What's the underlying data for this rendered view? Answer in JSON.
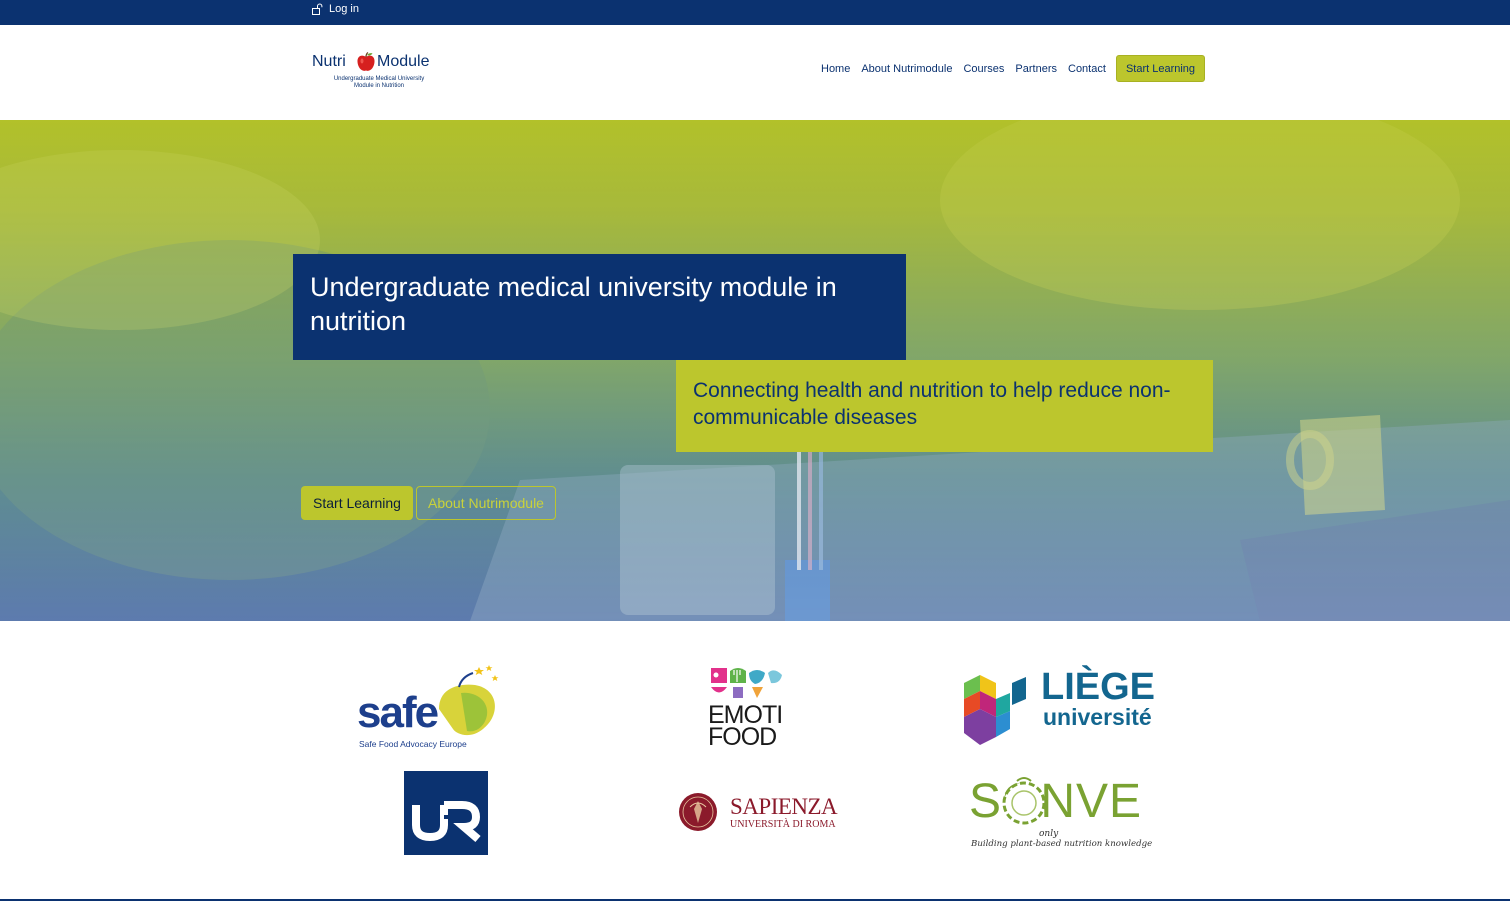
{
  "topbar": {
    "login_label": "Log in"
  },
  "logo": {
    "word1": "Nutri",
    "word2": "Module",
    "tagline_line1": "Undergraduate Medical University",
    "tagline_line2": "Module in Nutrition"
  },
  "nav": {
    "items": [
      {
        "label": "Home"
      },
      {
        "label": "About Nutrimodule"
      },
      {
        "label": "Courses"
      },
      {
        "label": "Partners"
      },
      {
        "label": "Contact"
      }
    ],
    "cta_label": "Start Learning"
  },
  "hero": {
    "headline": "Undergraduate medical university module in nutrition",
    "subheadline": "Connecting health and nutrition to help reduce non-communicable diseases",
    "primary_button": "Start Learning",
    "secondary_button": "About Nutrimodule"
  },
  "partners": {
    "safe": {
      "name": "safe",
      "subtitle": "Safe Food Advocacy Europe"
    },
    "emotifood": {
      "line1": "EMOTI",
      "line2": "FOOD"
    },
    "liege": {
      "line1": "LIÈGE",
      "line2": "université"
    },
    "ur": {
      "mark": "UR"
    },
    "sapienza": {
      "line1": "SAPIENZA",
      "line2": "UNIVERSITÀ DI ROMA"
    },
    "sonve": {
      "word": "SONVE",
      "small": "only",
      "tagline": "Building plant-based nutrition knowledge"
    }
  },
  "colors": {
    "brand_blue": "#0b3270",
    "brand_lime": "#bcc62d",
    "sonve_green": "#7aa232",
    "sapienza_red": "#8b1a2b",
    "safe_blue": "#1d3f8c"
  }
}
